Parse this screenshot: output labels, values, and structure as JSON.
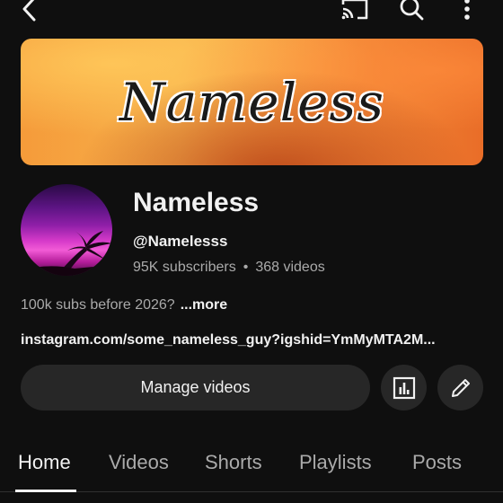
{
  "icons": {
    "back": "back-arrow-icon",
    "cast": "cast-icon",
    "search": "search-icon",
    "more": "more-vertical-icon",
    "analytics": "analytics-icon",
    "edit": "pencil-icon"
  },
  "banner": {
    "title": "Nameless"
  },
  "channel": {
    "name": "Nameless",
    "handle": "@Namelesss",
    "subscribers": "95K subscribers",
    "separator": "•",
    "videos": "368 videos"
  },
  "description": {
    "text": "100k subs before 2026?",
    "more": "...more"
  },
  "link": {
    "text": "instagram.com/some_nameless_guy?igshid=YmMyMTA2M..."
  },
  "actions": {
    "manage_label": "Manage videos"
  },
  "tabs": [
    {
      "label": "Home",
      "active": true
    },
    {
      "label": "Videos",
      "active": false
    },
    {
      "label": "Shorts",
      "active": false
    },
    {
      "label": "Playlists",
      "active": false
    },
    {
      "label": "Posts",
      "active": false
    }
  ],
  "colors": {
    "background": "#0f0f0f",
    "button_bg": "#272727",
    "text_primary": "#f1f1f1",
    "text_secondary": "#aaaaaa"
  }
}
